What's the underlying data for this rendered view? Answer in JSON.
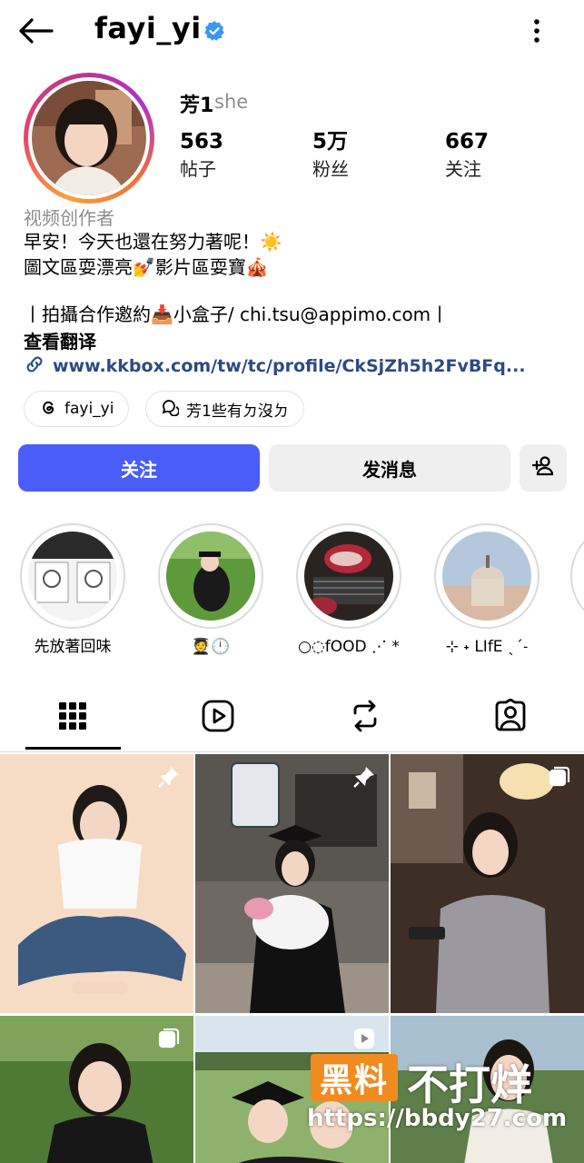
{
  "header": {
    "username": "fayi_yi",
    "icons": [
      "back-arrow-icon",
      "verified-badge-icon",
      "more-vertical-icon"
    ]
  },
  "profile": {
    "display_name": "芳1",
    "pronoun": "she",
    "stats": [
      {
        "value": "563",
        "label": "帖子"
      },
      {
        "value": "5万",
        "label": "粉丝"
      },
      {
        "value": "667",
        "label": "关注"
      }
    ],
    "category": "视频创作者",
    "bio": [
      "早安！今天也還在努力著呢！☀️",
      "圖文區耍漂亮💅影片區耍寶🎪",
      "",
      "丨拍攝合作邀約📥小盒子/ chi.tsu@appimo.com丨"
    ],
    "see_translation": "查看翻译",
    "link": "www.kkbox.com/tw/tc/profile/CkSjZh5h2FvBFq..."
  },
  "chips": [
    {
      "label": "fayi_yi",
      "icon": "threads-icon"
    },
    {
      "label": "芳1些有ㄉ沒ㄉ",
      "icon": "chat-bubble-icon"
    }
  ],
  "actions": {
    "follow": "关注",
    "message": "发消息",
    "add_user_icon": "add-user-icon"
  },
  "highlights": [
    {
      "label": "先放著回味"
    },
    {
      "label": "🧑‍🎓🕛"
    },
    {
      "label": "○◌fOOD ⋰ *"
    },
    {
      "label": "⊹ ˖ LIfE ˎˊ˗"
    }
  ],
  "tabs": [
    {
      "name": "grid",
      "icon": "grid-icon",
      "active": true
    },
    {
      "name": "reels",
      "icon": "reels-icon",
      "active": false
    },
    {
      "name": "reposts",
      "icon": "repost-icon",
      "active": false
    },
    {
      "name": "tagged",
      "icon": "tagged-person-icon",
      "active": false
    }
  ],
  "posts": [
    {
      "badge": "pin-icon"
    },
    {
      "badge": "pin-icon"
    },
    {
      "badge": "carousel-icon"
    },
    {
      "badge": "carousel-icon"
    },
    {
      "badge": "reel-icon"
    },
    {
      "badge": ""
    }
  ],
  "watermark": {
    "box_text": "黑料",
    "text": "不打烊",
    "url": "https://bbdy27.com"
  },
  "colors": {
    "accent_blue": "#4a5df9",
    "verified_blue": "#3897f0",
    "secondary_button": "#efefef",
    "link_color": "#2b4a86",
    "muted_text": "#8e8e8e",
    "watermark_orange": "#f08c1f"
  }
}
